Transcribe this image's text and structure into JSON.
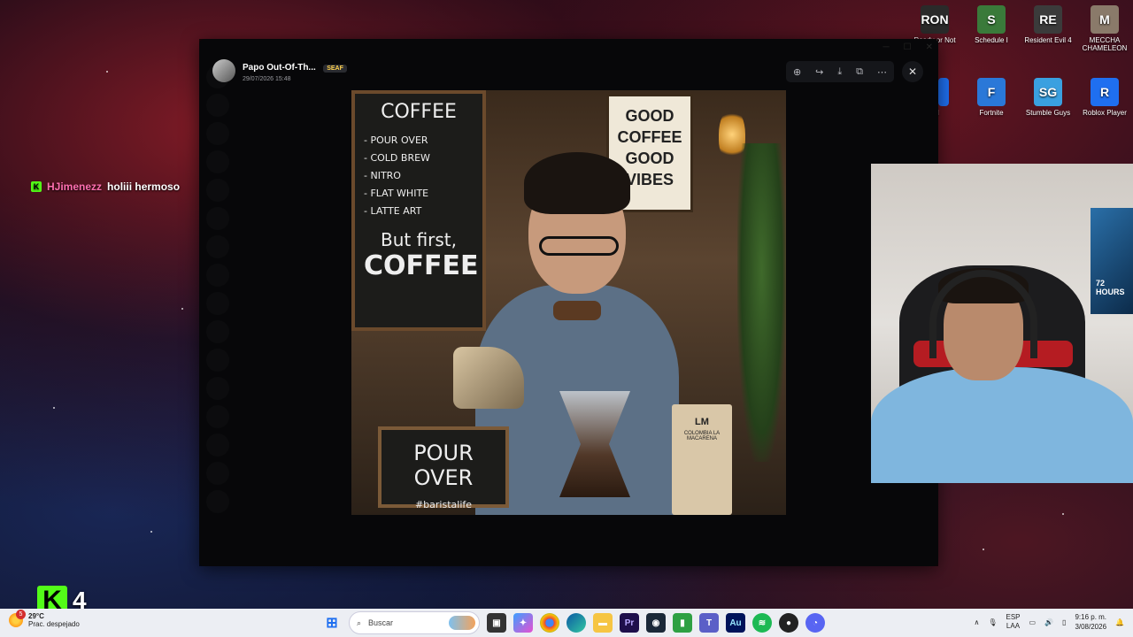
{
  "chat": {
    "username": "HJimenezz",
    "message": "holiii hermoso",
    "badge_letter": "K"
  },
  "kick_counter": {
    "letter": "K",
    "count": "4"
  },
  "desktop_icons": [
    {
      "label": "Ready or Not",
      "color": "#2a2a2a",
      "glyph": "RON"
    },
    {
      "label": "Schedule I",
      "color": "#3a7a3a",
      "glyph": "S"
    },
    {
      "label": "Resident Evil 4",
      "color": "#3b3b3b",
      "glyph": "RE"
    },
    {
      "label": "MECCHA CHAMELEON",
      "color": "#8a7a6a",
      "glyph": "M"
    },
    {
      "label": "Fortnite",
      "color": "#2a78d8",
      "glyph": "F"
    },
    {
      "label": "Stumble Guys",
      "color": "#3aa0e0",
      "glyph": "SG"
    },
    {
      "label": "Roblox Player",
      "color": "#1f6ff0",
      "glyph": "R"
    },
    {
      "label": "ead",
      "color": "#1f6ff0",
      "glyph": ""
    }
  ],
  "viewer": {
    "author": "Papo Out-Of-Th...",
    "tag": "SEAF",
    "timestamp": "29/07/2026 15:48",
    "tools": [
      "zoom-icon",
      "forward-icon",
      "download-icon",
      "open-external-icon",
      "more-icon"
    ]
  },
  "photo": {
    "board_title": "COFFEE",
    "board_items": [
      "- POUR OVER",
      "- COLD BREW",
      "- NITRO",
      "- FLAT WHITE",
      "- LATTE ART"
    ],
    "board_footer_1": "But first,",
    "board_footer_2": "COFFEE",
    "sign_lines": [
      "GOOD",
      "COFFEE",
      "GOOD",
      "VIBES"
    ],
    "pour_title": "POUR OVER",
    "pour_tag": "#baristalife",
    "bag_brand": "LM",
    "bag_text": "COLOMBIA LA MACARENA"
  },
  "webcam": {
    "tv_text": "72 HOURS"
  },
  "taskbar": {
    "weather_badge": "5",
    "weather_temp": "29°C",
    "weather_desc": "Prac. despejado",
    "search_placeholder": "Buscar",
    "lang_line1": "ESP",
    "lang_line2": "LAA",
    "time": "9:16 p. m.",
    "date": "3/08/2026"
  }
}
